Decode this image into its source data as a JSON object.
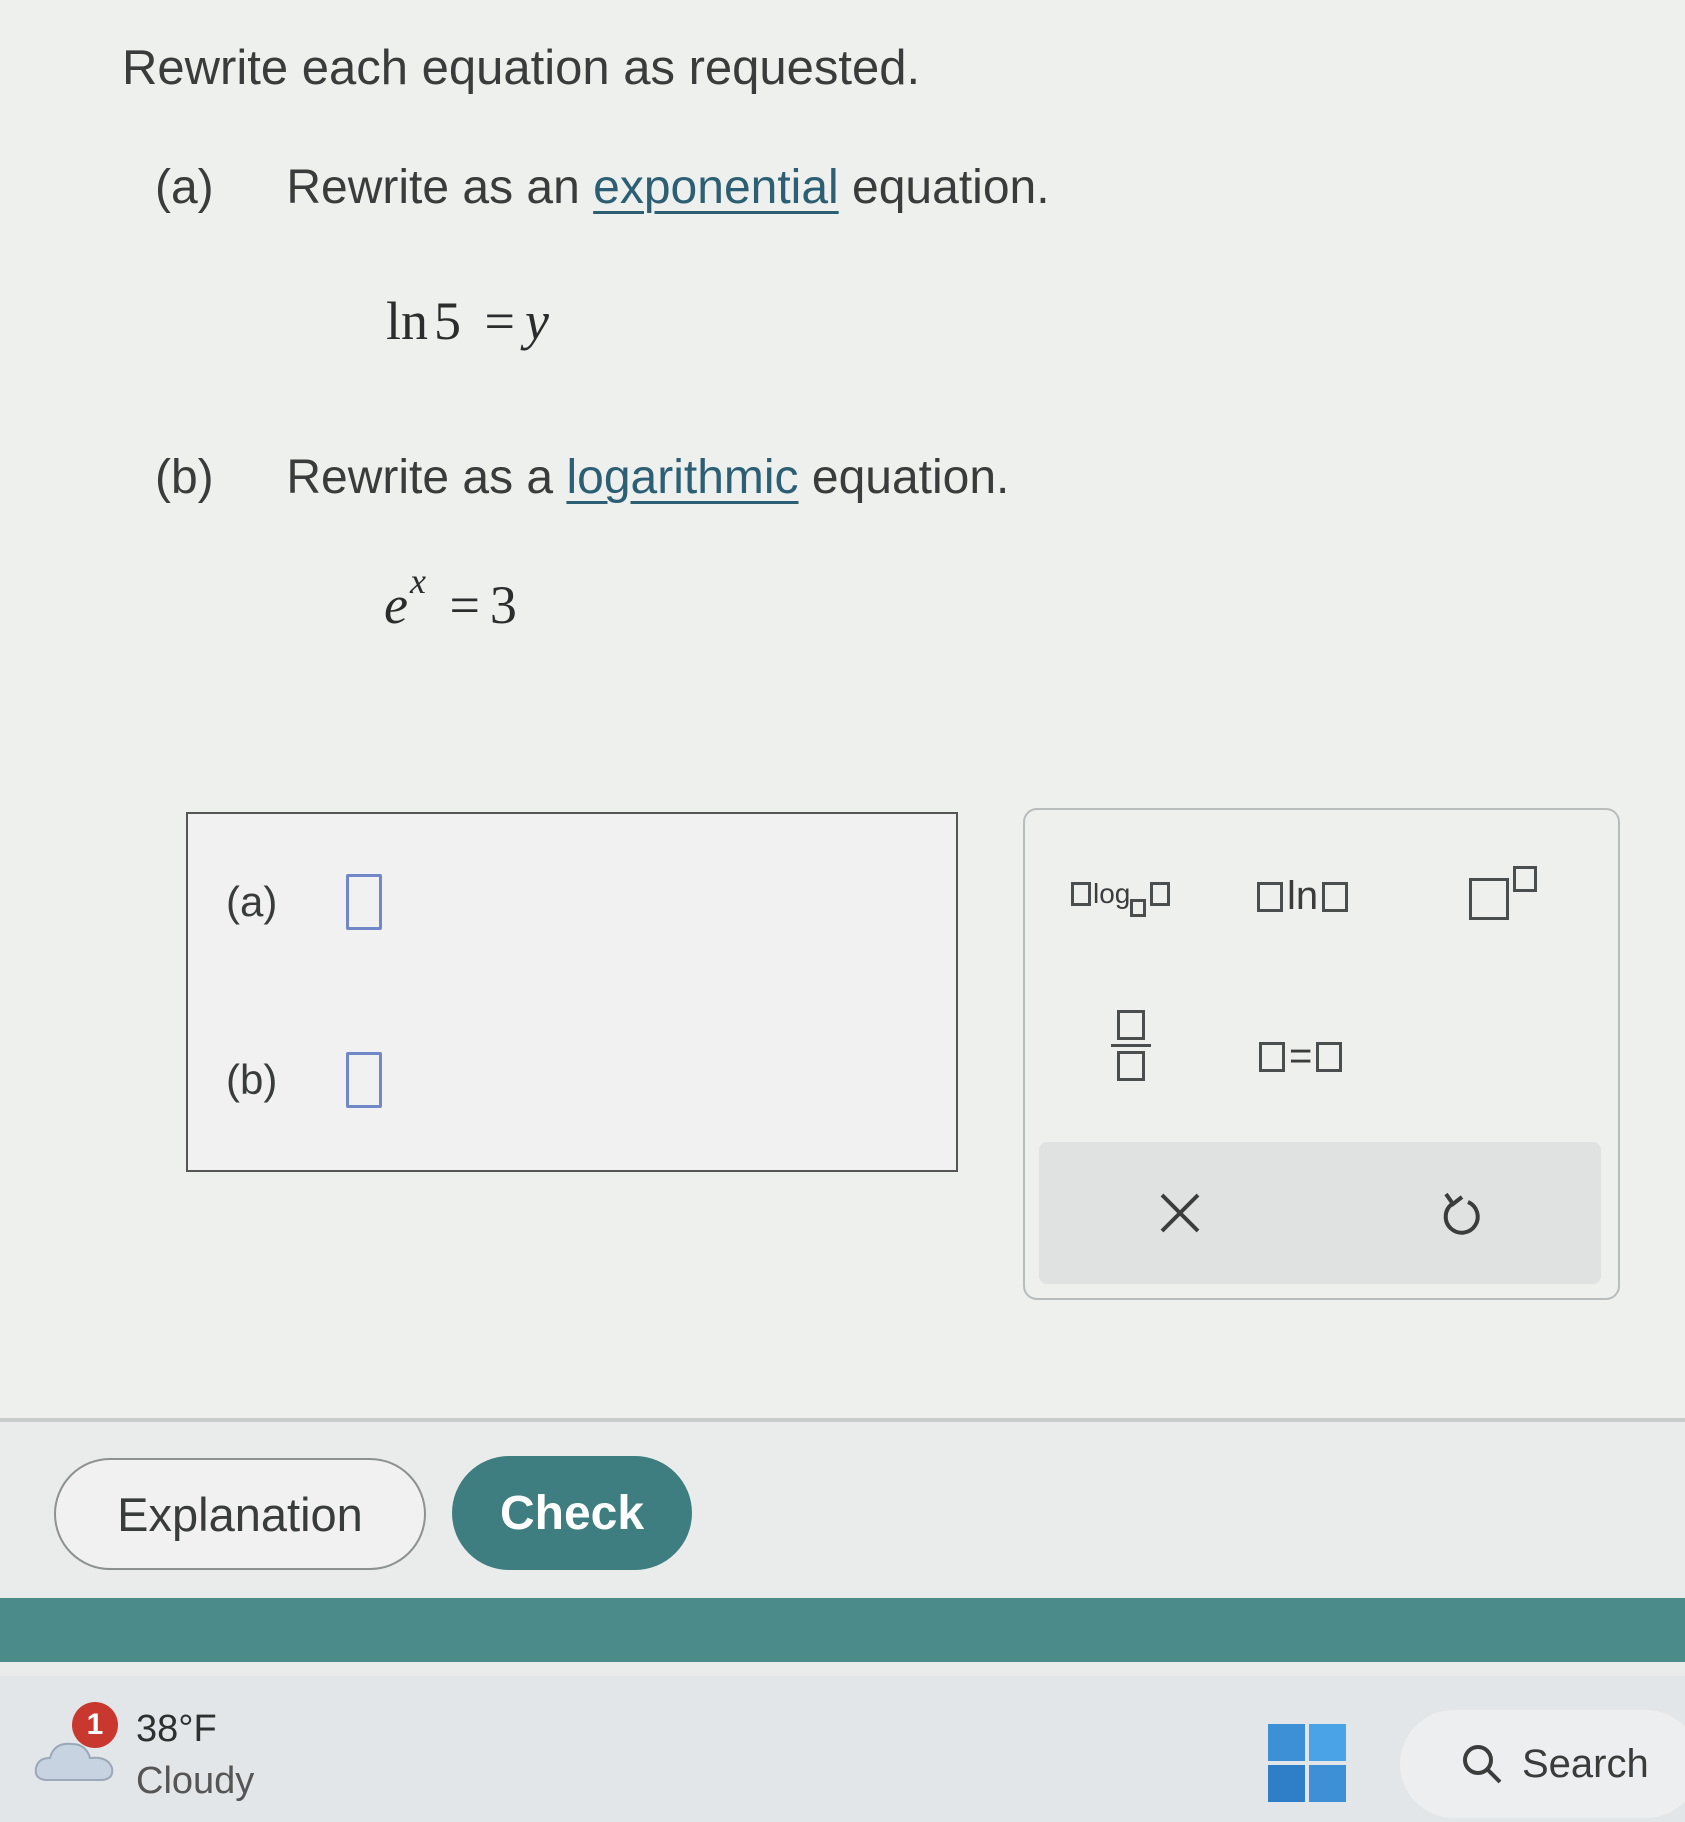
{
  "instructions": "Rewrite each equation as requested.",
  "parts": [
    {
      "label": "(a)",
      "prefix": "Rewrite as an",
      "keyword": "exponential",
      "suffix": "equation."
    },
    {
      "label": "(b)",
      "prefix": "Rewrite as a",
      "keyword": "logarithmic",
      "suffix": "equation."
    }
  ],
  "equations": {
    "a": {
      "fn": "ln",
      "arg": "5",
      "eq": "=",
      "rhs": "y"
    },
    "b": {
      "base": "e",
      "exp": "x",
      "eq": "=",
      "rhs": "3"
    }
  },
  "answers": [
    {
      "label": "(a)",
      "value": ""
    },
    {
      "label": "(b)",
      "value": ""
    }
  ],
  "palette": {
    "log_label": "log",
    "ln_label": "ln",
    "equals_label": "=",
    "clear_icon": "close-icon",
    "undo_icon": "undo-icon"
  },
  "buttons": {
    "explanation": "Explanation",
    "check": "Check"
  },
  "taskbar": {
    "notification_count": "1",
    "temperature": "38°F",
    "condition": "Cloudy",
    "search_label": "Search"
  },
  "colors": {
    "accent": "#3e7e80",
    "keyword_link": "#2c5f73",
    "answer_input_border": "#7088c8",
    "footer_band": "#4b8c8a",
    "badge": "#c8382e"
  }
}
